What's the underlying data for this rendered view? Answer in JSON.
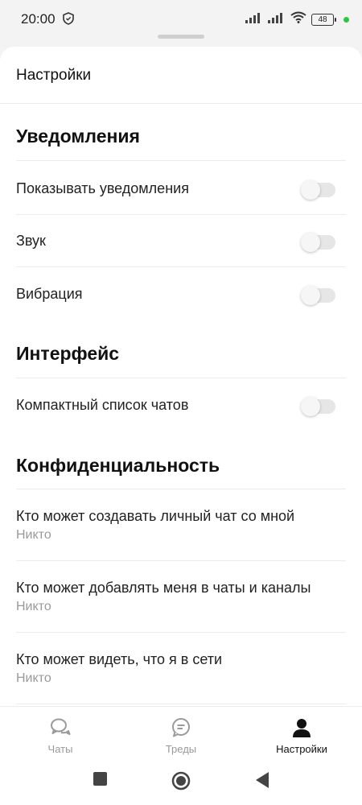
{
  "status_bar": {
    "time": "20:00",
    "battery": "48"
  },
  "header": {
    "title": "Настройки"
  },
  "sections": [
    {
      "title": "Уведомления"
    },
    {
      "title": "Интерфейс"
    },
    {
      "title": "Конфиденциальность"
    }
  ],
  "notifications": {
    "show": {
      "label": "Показывать уведомления",
      "enabled": false
    },
    "sound": {
      "label": "Звук",
      "enabled": false
    },
    "vibration": {
      "label": "Вибрация",
      "enabled": false
    }
  },
  "interface": {
    "compact": {
      "label": "Компактный список чатов",
      "enabled": false
    }
  },
  "privacy": [
    {
      "label": "Кто может создавать личный чат со мной",
      "value": "Никто"
    },
    {
      "label": "Кто может добавлять меня в чаты и каналы",
      "value": "Никто"
    },
    {
      "label": "Кто может видеть, что я в сети",
      "value": "Никто"
    }
  ],
  "bottom_nav": [
    {
      "label": "Чаты",
      "icon": "chats-icon",
      "active": false
    },
    {
      "label": "Треды",
      "icon": "threads-icon",
      "active": false
    },
    {
      "label": "Настройки",
      "icon": "profile-icon",
      "active": true
    }
  ],
  "colors": {
    "active": "#111111",
    "inactive": "#9a9a9a",
    "toggle_off": "#e6e6e6"
  }
}
